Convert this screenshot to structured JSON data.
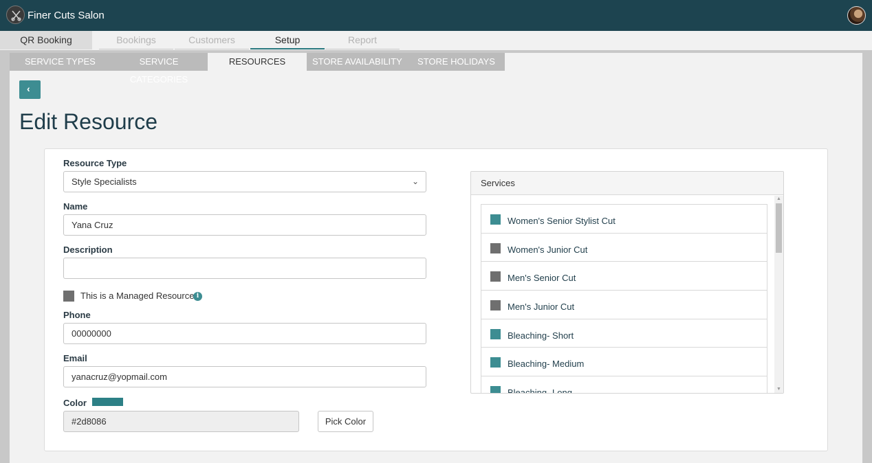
{
  "app": {
    "title": "Finer Cuts Salon"
  },
  "nav": {
    "tabs": [
      "QR Booking",
      "Bookings",
      "Customers",
      "Setup",
      "Report"
    ],
    "active": "Setup"
  },
  "subnav": {
    "tabs": [
      "SERVICE TYPES",
      "SERVICE CATEGORIES",
      "RESOURCES",
      "STORE AVAILABILITY",
      "STORE HOLIDAYS"
    ],
    "active": "RESOURCES"
  },
  "page": {
    "title": "Edit Resource"
  },
  "form": {
    "resource_type_label": "Resource Type",
    "resource_type_value": "Style Specialists",
    "name_label": "Name",
    "name_value": "Yana Cruz",
    "description_label": "Description",
    "description_value": "",
    "managed_label": "This is a Managed Resource",
    "phone_label": "Phone",
    "phone_value": "00000000",
    "email_label": "Email",
    "email_value": "yanacruz@yopmail.com",
    "color_label": "Color",
    "color_value": "#2d8086",
    "pick_color_label": "Pick Color"
  },
  "services": {
    "title": "Services",
    "items": [
      {
        "label": "Women's Senior Stylist Cut",
        "checked": true
      },
      {
        "label": "Women's Junior Cut",
        "checked": false
      },
      {
        "label": "Men's Senior Cut",
        "checked": false
      },
      {
        "label": "Men's Junior Cut",
        "checked": false
      },
      {
        "label": "Bleaching- Short",
        "checked": true
      },
      {
        "label": "Bleaching- Medium",
        "checked": true
      },
      {
        "label": "Bleaching- Long",
        "checked": true
      }
    ]
  },
  "colors": {
    "header": "#1d4450",
    "accent": "#3d8d92",
    "swatch": "#2d8086",
    "unchecked": "#6f6f6f"
  },
  "icons": {
    "back": "chevron-left-icon",
    "info": "info-icon",
    "dropdown": "chevron-down-icon"
  }
}
